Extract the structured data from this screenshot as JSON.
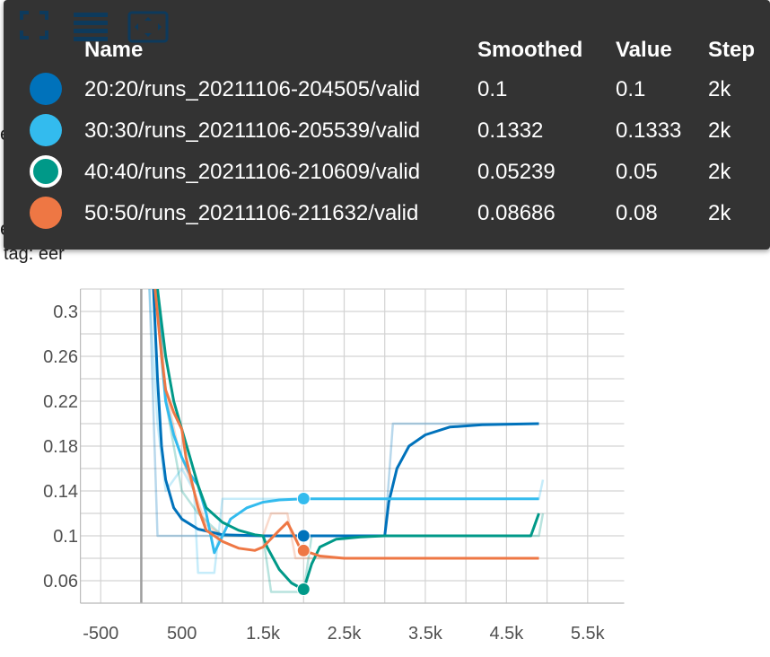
{
  "background": {
    "card_title": "eer",
    "run_label": "eer",
    "tag_label": "tag: eer"
  },
  "tooltip": {
    "headers": {
      "name": "Name",
      "smoothed": "Smoothed",
      "value": "Value",
      "step": "Step"
    },
    "rows": [
      {
        "name": "20:20/runs_20211106-204505/valid",
        "smoothed": "0.1",
        "value": "0.1",
        "step": "2k",
        "color": "#0072bb"
      },
      {
        "name": "30:30/runs_20211106-205539/valid",
        "smoothed": "0.1332",
        "value": "0.1333",
        "step": "2k",
        "color": "#33bbee"
      },
      {
        "name": "40:40/runs_20211106-210609/valid",
        "smoothed": "0.05239",
        "value": "0.05",
        "step": "2k",
        "color": "#009988"
      },
      {
        "name": "50:50/runs_20211106-211632/valid",
        "smoothed": "0.08686",
        "value": "0.08",
        "step": "2k",
        "color": "#ee7744"
      }
    ],
    "icons": [
      "fullscreen-icon",
      "toggle-log-lines-icon",
      "fit-domain-icon"
    ]
  },
  "chart_data": {
    "type": "line",
    "title": "",
    "xlabel": "",
    "ylabel": "",
    "xlim": [
      -1000,
      6000
    ],
    "ylim": [
      0.04,
      0.32
    ],
    "x_ticks": [
      -500,
      0,
      500,
      1000,
      1500,
      2000,
      2500,
      3000,
      3500,
      4000,
      4500,
      5000,
      5500
    ],
    "x_tick_labels": [
      "-500",
      "",
      "500",
      "",
      "1.5k",
      "",
      "2.5k",
      "",
      "3.5k",
      "",
      "4.5k",
      "",
      "5.5k"
    ],
    "y_ticks": [
      0.04,
      0.06,
      0.08,
      0.1,
      0.12,
      0.14,
      0.16,
      0.18,
      0.2,
      0.22,
      0.24,
      0.26,
      0.28,
      0.3,
      0.32
    ],
    "y_tick_labels": [
      "",
      "0.06",
      "",
      "0.1",
      "",
      "0.14",
      "",
      "0.18",
      "",
      "0.22",
      "",
      "0.26",
      "",
      "0.3",
      ""
    ],
    "grid": true,
    "hover_step": 2000,
    "series": [
      {
        "name": "20:20/runs_20211106-204505/valid",
        "color": "#0072bb",
        "raw": [
          [
            100,
            0.32
          ],
          [
            200,
            0.1
          ],
          [
            3000,
            0.1
          ],
          [
            3100,
            0.2
          ],
          [
            4900,
            0.2
          ]
        ],
        "smoothed": [
          [
            150,
            0.32
          ],
          [
            200,
            0.24
          ],
          [
            250,
            0.18
          ],
          [
            300,
            0.15
          ],
          [
            400,
            0.125
          ],
          [
            500,
            0.115
          ],
          [
            700,
            0.106
          ],
          [
            1000,
            0.101
          ],
          [
            1500,
            0.1
          ],
          [
            3000,
            0.1
          ],
          [
            3050,
            0.13
          ],
          [
            3150,
            0.16
          ],
          [
            3300,
            0.18
          ],
          [
            3500,
            0.19
          ],
          [
            3800,
            0.197
          ],
          [
            4200,
            0.199
          ],
          [
            4900,
            0.2
          ]
        ]
      },
      {
        "name": "30:30/runs_20211106-205539/valid",
        "color": "#33bbee",
        "raw": [
          [
            100,
            0.32
          ],
          [
            200,
            0.2
          ],
          [
            300,
            0.14
          ],
          [
            500,
            0.16
          ],
          [
            650,
            0.14
          ],
          [
            700,
            0.067
          ],
          [
            900,
            0.067
          ],
          [
            1000,
            0.133
          ],
          [
            4900,
            0.133
          ],
          [
            4950,
            0.15
          ]
        ],
        "smoothed": [
          [
            200,
            0.32
          ],
          [
            250,
            0.26
          ],
          [
            300,
            0.22
          ],
          [
            400,
            0.19
          ],
          [
            500,
            0.17
          ],
          [
            600,
            0.155
          ],
          [
            700,
            0.145
          ],
          [
            800,
            0.12
          ],
          [
            900,
            0.085
          ],
          [
            1000,
            0.1
          ],
          [
            1100,
            0.115
          ],
          [
            1300,
            0.125
          ],
          [
            1500,
            0.13
          ],
          [
            1700,
            0.132
          ],
          [
            2000,
            0.133
          ],
          [
            4900,
            0.133
          ]
        ]
      },
      {
        "name": "40:40/runs_20211106-210609/valid",
        "color": "#009988",
        "raw": [
          [
            200,
            0.32
          ],
          [
            300,
            0.22
          ],
          [
            500,
            0.14
          ],
          [
            700,
            0.12
          ],
          [
            1000,
            0.1
          ],
          [
            1500,
            0.1
          ],
          [
            1600,
            0.05
          ],
          [
            2000,
            0.05
          ],
          [
            2100,
            0.1
          ],
          [
            4900,
            0.1
          ],
          [
            4950,
            0.12
          ]
        ],
        "smoothed": [
          [
            200,
            0.32
          ],
          [
            250,
            0.29
          ],
          [
            300,
            0.26
          ],
          [
            400,
            0.22
          ],
          [
            500,
            0.195
          ],
          [
            600,
            0.17
          ],
          [
            700,
            0.145
          ],
          [
            800,
            0.125
          ],
          [
            1000,
            0.112
          ],
          [
            1200,
            0.105
          ],
          [
            1400,
            0.101
          ],
          [
            1500,
            0.1
          ],
          [
            1550,
            0.09
          ],
          [
            1700,
            0.07
          ],
          [
            1850,
            0.058
          ],
          [
            2000,
            0.052
          ],
          [
            2100,
            0.075
          ],
          [
            2200,
            0.09
          ],
          [
            2400,
            0.097
          ],
          [
            2700,
            0.099
          ],
          [
            3000,
            0.1
          ],
          [
            4800,
            0.1
          ],
          [
            4900,
            0.12
          ]
        ]
      },
      {
        "name": "50:50/runs_20211106-211632/valid",
        "color": "#ee7744",
        "raw": [
          [
            200,
            0.32
          ],
          [
            300,
            0.23
          ],
          [
            450,
            0.18
          ],
          [
            550,
            0.16
          ],
          [
            650,
            0.14
          ],
          [
            800,
            0.11
          ],
          [
            1000,
            0.1
          ],
          [
            1500,
            0.1
          ],
          [
            1600,
            0.12
          ],
          [
            1800,
            0.12
          ],
          [
            1900,
            0.08
          ],
          [
            4900,
            0.08
          ]
        ],
        "smoothed": [
          [
            170,
            0.32
          ],
          [
            250,
            0.26
          ],
          [
            300,
            0.23
          ],
          [
            400,
            0.21
          ],
          [
            500,
            0.195
          ],
          [
            550,
            0.17
          ],
          [
            600,
            0.155
          ],
          [
            700,
            0.125
          ],
          [
            800,
            0.105
          ],
          [
            1000,
            0.095
          ],
          [
            1200,
            0.089
          ],
          [
            1400,
            0.087
          ],
          [
            1500,
            0.09
          ],
          [
            1700,
            0.105
          ],
          [
            1800,
            0.112
          ],
          [
            1850,
            0.105
          ],
          [
            1950,
            0.09
          ],
          [
            2000,
            0.087
          ],
          [
            2200,
            0.082
          ],
          [
            2500,
            0.08
          ],
          [
            4900,
            0.08
          ]
        ]
      }
    ]
  }
}
